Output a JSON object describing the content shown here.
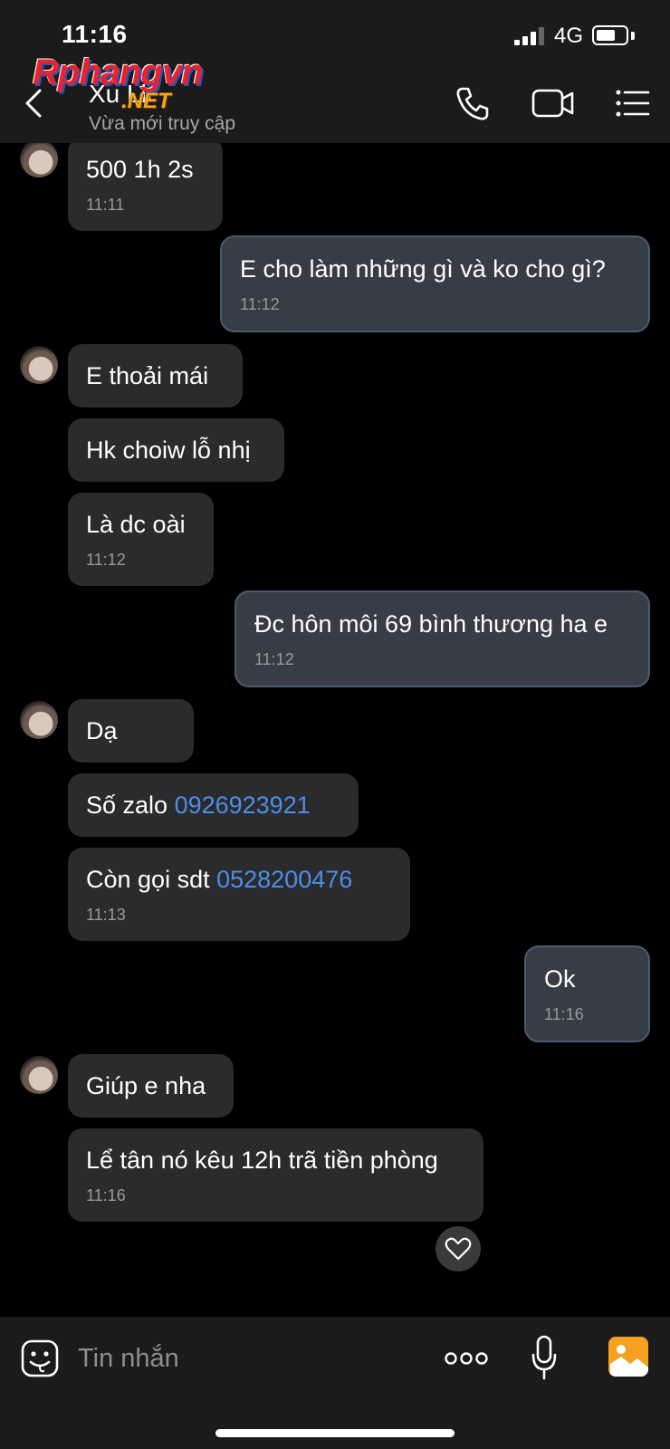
{
  "status_bar": {
    "time": "11:16",
    "network": "4G",
    "battery_level": 0.65
  },
  "header": {
    "contact_name": "Xu Lii",
    "contact_status": "Vừa mới truy cập",
    "watermark": "Rphangvn",
    "watermark_sub": ".NET"
  },
  "messages": [
    {
      "dir": "in",
      "lines": [
        {
          "text": "500 1h 2s"
        }
      ],
      "time": "11:11"
    },
    {
      "dir": "out",
      "lines": [
        {
          "text": "E cho làm những gì và ko cho gì?"
        }
      ],
      "time": "11:12"
    },
    {
      "dir": "in",
      "lines": [
        {
          "text": "E thoải mái"
        }
      ]
    },
    {
      "dir": "in",
      "lines": [
        {
          "text": "Hk choiw lỗ nhị"
        }
      ]
    },
    {
      "dir": "in",
      "lines": [
        {
          "text": "Là dc oài"
        }
      ],
      "time": "11:12"
    },
    {
      "dir": "out",
      "lines": [
        {
          "text": "Đc hôn môi 69 bình thương ha e"
        }
      ],
      "time": "11:12"
    },
    {
      "dir": "in",
      "lines": [
        {
          "text": "Dạ"
        }
      ]
    },
    {
      "dir": "in",
      "lines": [
        {
          "text": "Số zalo ",
          "link": "0926923921"
        }
      ]
    },
    {
      "dir": "in",
      "lines": [
        {
          "text": "Còn gọi sdt ",
          "link": "0528200476"
        }
      ],
      "time": "11:13"
    },
    {
      "dir": "out",
      "lines": [
        {
          "text": "Ok"
        }
      ],
      "time": "11:16"
    },
    {
      "dir": "in",
      "lines": [
        {
          "text": "Giúp e nha"
        }
      ]
    },
    {
      "dir": "in",
      "lines": [
        {
          "text": "Lể tân nó kêu 12h trã tiền phòng"
        }
      ],
      "time": "11:16"
    }
  ],
  "composer": {
    "placeholder": "Tin nhắn"
  },
  "colors": {
    "incoming_bubble": "#2b2b2d",
    "outgoing_bubble": "#373d46",
    "link": "#4c8ee8",
    "photo_button": "#f4a021"
  },
  "icons": [
    "back-icon",
    "phone-icon",
    "video-call-icon",
    "menu-list-icon",
    "heart-icon",
    "sticker-icon",
    "more-icon",
    "microphone-icon",
    "photo-icon"
  ]
}
